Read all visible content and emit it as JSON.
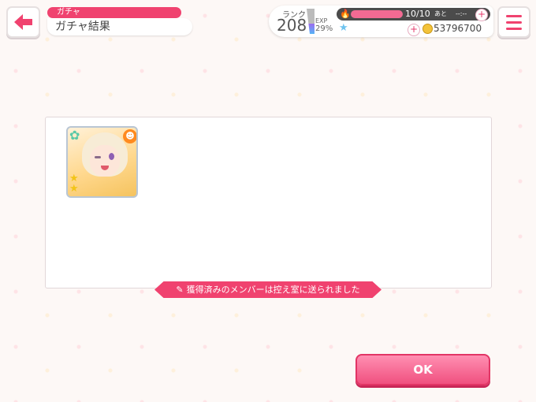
{
  "header": {
    "category": "ガチャ",
    "title": "ガチャ結果"
  },
  "status": {
    "rank_label": "ランク",
    "rank_value": "208",
    "exp_label": "EXP",
    "exp_percent": "29%",
    "stamina": "10/10",
    "stamina_fraction": 1.0,
    "recovery_label": "あと",
    "recovery_time": "--:--",
    "coins": "53796700"
  },
  "result": {
    "card": {
      "rarity_stars": 2,
      "attribute": "happy"
    },
    "banner_text": "獲得済みのメンバーは控え室に送られました"
  },
  "actions": {
    "ok_label": "OK"
  },
  "colors": {
    "accent": "#f0426f",
    "button": "#f0507f"
  }
}
